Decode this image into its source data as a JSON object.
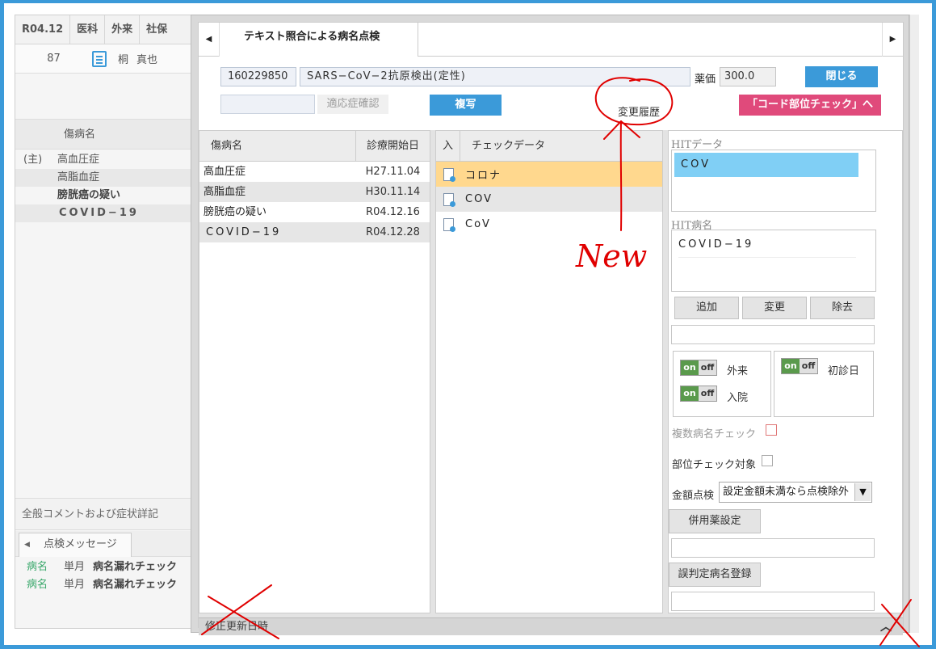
{
  "background": {
    "header": [
      "R04.12",
      "医科",
      "外来",
      "社保"
    ],
    "patient": {
      "number": "87",
      "surname": "桐",
      "given_name": "真也"
    },
    "section_title": "傷病名",
    "diseases": [
      {
        "prefix": "(主)",
        "name": "高血圧症"
      },
      {
        "prefix": "",
        "name": "高脂血症"
      },
      {
        "prefix": "",
        "name": "膀胱癌の疑い"
      },
      {
        "prefix": "",
        "name": "COVID−19"
      }
    ],
    "comment_title": "全般コメントおよび症状詳記",
    "tab_label": "点検メッセージ",
    "messages": [
      {
        "kind": "病名",
        "period": "単月",
        "text": "病名漏れチェック"
      },
      {
        "kind": "病名",
        "period": "単月",
        "text": "病名漏れチェック"
      }
    ]
  },
  "modal": {
    "tab_title": "テキスト照合による病名点検",
    "code": "160229850",
    "item_name": "SARS−CoV−2抗原検出(定性)",
    "price_label": "薬価",
    "price_value": "300.0",
    "close_label": "閉じる",
    "indication_label": "適応症確認",
    "copy_label": "複写",
    "history_label": "変更履歴",
    "code_check_label": "「コード部位チェック」へ",
    "disease_grid": {
      "col_name": "傷病名",
      "col_date": "診療開始日",
      "rows": [
        {
          "name": "高血圧症",
          "date": "H27.11.04"
        },
        {
          "name": "高脂血症",
          "date": "H30.11.14"
        },
        {
          "name": "膀胱癌の疑い",
          "date": "R04.12.16"
        },
        {
          "name": "COVID−19",
          "date": "R04.12.28"
        }
      ]
    },
    "check_grid": {
      "col_in": "入",
      "col_data": "チェックデータ",
      "rows": [
        {
          "text": "コロナ",
          "state": "selected"
        },
        {
          "text": "COV",
          "state": "alt"
        },
        {
          "text": "CoV",
          "state": "normal"
        }
      ]
    },
    "right": {
      "hit_data_label": "HITデータ",
      "hit_data_value": "COV",
      "hit_name_label": "HIT病名",
      "hit_name_value": "COVID−19",
      "add_label": "追加",
      "change_label": "変更",
      "remove_label": "除去",
      "toggle_on": "on",
      "toggle_off": "off",
      "outpatient_label": "外来",
      "inpatient_label": "入院",
      "first_visit_label": "初診日",
      "multi_check_label": "複数病名チェック",
      "part_check_label": "部位チェック対象",
      "amount_label": "金額点検",
      "amount_value": "設定金額未満なら点検除外",
      "concomitant_label": "併用薬設定",
      "misjudge_label": "誤判定病名登録"
    },
    "footer_label": "修正更新日時"
  },
  "annotation": {
    "text": "New"
  },
  "colors": {
    "accent": "#3b9ad9",
    "pink": "#e04a7b",
    "highlight": "#ffd88e",
    "hit": "#80cff5",
    "ink": "#e00000"
  }
}
